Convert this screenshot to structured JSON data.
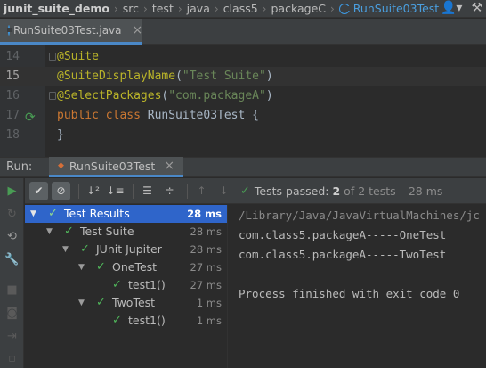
{
  "breadcrumb": {
    "project": "junit_suite_demo",
    "items": [
      "src",
      "test",
      "java",
      "class5",
      "packageC"
    ],
    "active": "RunSuite03Test"
  },
  "editor": {
    "tab_label": "RunSuite03Test.java",
    "lines": [
      {
        "number": "14",
        "code": [
          {
            "t": "@Suite",
            "c": "ann"
          }
        ]
      },
      {
        "number": "15",
        "code": [
          {
            "t": "@SuiteDisplayName",
            "c": "ann"
          },
          {
            "t": "(",
            "c": "pl"
          },
          {
            "t": "\"Test Suite\"",
            "c": "str"
          },
          {
            "t": ")",
            "c": "pl"
          }
        ]
      },
      {
        "number": "16",
        "code": [
          {
            "t": "@SelectPackages",
            "c": "ann"
          },
          {
            "t": "(",
            "c": "pl"
          },
          {
            "t": "\"com.packageA\"",
            "c": "str"
          },
          {
            "t": ")",
            "c": "pl"
          }
        ]
      },
      {
        "number": "17",
        "code": [
          {
            "t": "public class ",
            "c": "kw"
          },
          {
            "t": "RunSuite03Test {",
            "c": "pl"
          }
        ]
      },
      {
        "number": "18",
        "code": [
          {
            "t": "}",
            "c": "pl"
          }
        ]
      }
    ]
  },
  "run": {
    "label": "Run:",
    "tab_label": "RunSuite03Test",
    "status": {
      "prefix": "Tests passed:",
      "count": "2",
      "suffix": "of 2 tests – 28 ms"
    }
  },
  "tree": [
    {
      "name": "Test Results",
      "time": "28 ms",
      "level": 0,
      "expanded": true,
      "selected": true
    },
    {
      "name": "Test Suite",
      "time": "28 ms",
      "level": 1,
      "expanded": true
    },
    {
      "name": "JUnit Jupiter",
      "time": "28 ms",
      "level": 2,
      "expanded": true
    },
    {
      "name": "OneTest",
      "time": "27 ms",
      "level": 3,
      "expanded": true
    },
    {
      "name": "test1()",
      "time": "27 ms",
      "level": 4,
      "expanded": false
    },
    {
      "name": "TwoTest",
      "time": "1 ms",
      "level": 3,
      "expanded": true
    },
    {
      "name": "test1()",
      "time": "1 ms",
      "level": 4,
      "expanded": false
    }
  ],
  "console": {
    "lines": [
      "/Library/Java/JavaVirtualMachines/jc",
      "com.class5.packageA-----OneTest",
      "com.class5.packageA-----TwoTest",
      "",
      "Process finished with exit code 0"
    ]
  }
}
